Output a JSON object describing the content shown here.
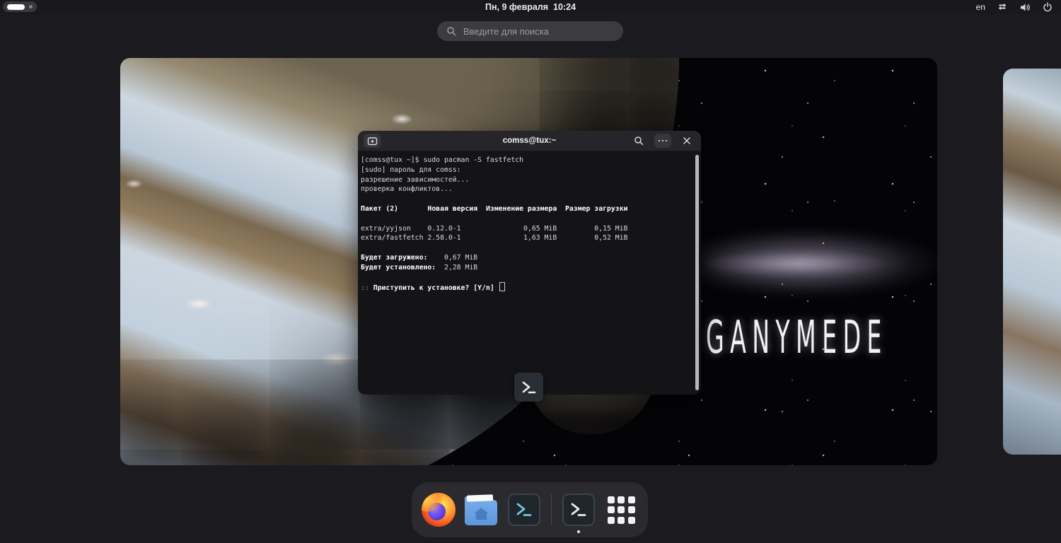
{
  "top_bar": {
    "clock": "Пн, 9 февраля  10:24",
    "keyboard_layout": "en",
    "icons": {
      "network": "bidirectional-arrows-icon",
      "volume": "speaker-high-icon",
      "power": "power-icon"
    },
    "workspaces": {
      "active": 1,
      "total": 2
    }
  },
  "search": {
    "placeholder": "Введите для поиска",
    "icon": "magnifier-icon"
  },
  "wallpaper": {
    "title": "GANYMEDE"
  },
  "terminal": {
    "title": "comss@tux:~",
    "header_icons": {
      "left": "new-tab-icon",
      "search": "magnifier-icon",
      "menu": "ellipsis-icon",
      "close": "close-icon"
    },
    "lines": {
      "cmd": "[comss@tux ~]$ sudo pacman -S fastfetch",
      "sudo": "[sudo] пароль для comss:",
      "resolve": "разрешение зависимостей...",
      "conflicts": "проверка конфликтов...",
      "table_header": "Пакет (2)       Новая версия  Изменение размера  Размер загрузки",
      "row_yyjson": "extra/yyjson    0.12.0-1               0,65 MiB         0,15 MiB",
      "row_fastfetch": "extra/fastfetch 2.58.0-1               1,63 MiB         0,52 MiB",
      "download_label": "Будет загружено:",
      "download_value": "    0,67 MiB",
      "install_label": "Будет установлено:",
      "install_value": "  2,28 MiB",
      "prompt_prefix": "::",
      "prompt_question": " Приступить к установке? [Y/n] "
    }
  },
  "dock": {
    "items": [
      {
        "name": "firefox",
        "icon": "firefox-icon"
      },
      {
        "name": "files",
        "icon": "files-folder-icon"
      },
      {
        "name": "terminal",
        "icon": "terminal-icon"
      },
      {
        "name": "console",
        "icon": "terminal-icon",
        "running": true
      },
      {
        "name": "show-apps",
        "icon": "app-grid-icon"
      }
    ]
  },
  "colors": {
    "shell_bg": "#1b1b1f",
    "dock_bg": "#2b2b2f",
    "terminal_bg": "#141417",
    "terminal_header_bg": "#26262a",
    "accent_cyan": "#6fc6e2",
    "folder_blue": "#68a3e7",
    "scrollbar": "#b8b8bc"
  }
}
